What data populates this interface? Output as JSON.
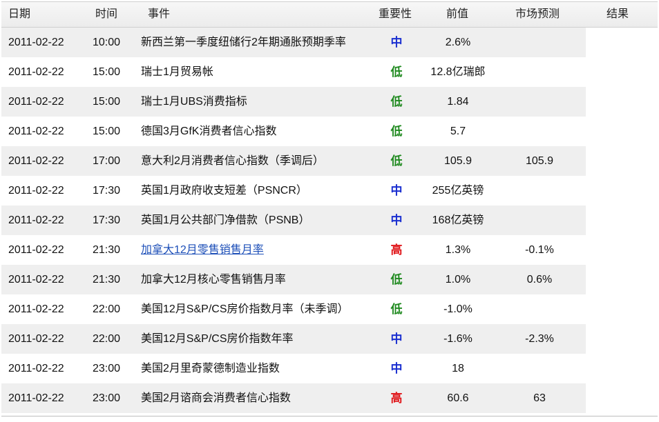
{
  "headers": {
    "date": "日期",
    "time": "时间",
    "event": "事件",
    "importance": "重要性",
    "previous": "前值",
    "forecast": "市场预测",
    "result": "结果"
  },
  "colors": {
    "importance_medium": "#1a2fd0",
    "importance_low": "#1f8a1f",
    "importance_high": "#e0161a",
    "link": "#1d4fb8"
  },
  "rows": [
    {
      "date": "2011-02-22",
      "time": "10:00",
      "event": "新西兰第一季度纽储行2年期通胀预期季率",
      "importance": "中",
      "previous": "2.6%",
      "forecast": "",
      "result": "",
      "link": false
    },
    {
      "date": "2011-02-22",
      "time": "15:00",
      "event": "瑞士1月贸易帐",
      "importance": "低",
      "previous": "12.8亿瑞郎",
      "forecast": "",
      "result": "",
      "link": false
    },
    {
      "date": "2011-02-22",
      "time": "15:00",
      "event": "瑞士1月UBS消费指标",
      "importance": "低",
      "previous": "1.84",
      "forecast": "",
      "result": "",
      "link": false
    },
    {
      "date": "2011-02-22",
      "time": "15:00",
      "event": "德国3月GfK消费者信心指数",
      "importance": "低",
      "previous": "5.7",
      "forecast": "",
      "result": "",
      "link": false
    },
    {
      "date": "2011-02-22",
      "time": "17:00",
      "event": "意大利2月消费者信心指数（季调后）",
      "importance": "低",
      "previous": "105.9",
      "forecast": "105.9",
      "result": "",
      "link": false
    },
    {
      "date": "2011-02-22",
      "time": "17:30",
      "event": "英国1月政府收支短差（PSNCR）",
      "importance": "中",
      "previous": "255亿英镑",
      "forecast": "",
      "result": "",
      "link": false
    },
    {
      "date": "2011-02-22",
      "time": "17:30",
      "event": "英国1月公共部门净借款（PSNB）",
      "importance": "中",
      "previous": "168亿英镑",
      "forecast": "",
      "result": "",
      "link": false
    },
    {
      "date": "2011-02-22",
      "time": "21:30",
      "event": "加拿大12月零售销售月率",
      "importance": "高",
      "previous": "1.3%",
      "forecast": "-0.1%",
      "result": "",
      "link": true
    },
    {
      "date": "2011-02-22",
      "time": "21:30",
      "event": "加拿大12月核心零售销售月率",
      "importance": "低",
      "previous": "1.0%",
      "forecast": "0.6%",
      "result": "",
      "link": false
    },
    {
      "date": "2011-02-22",
      "time": "22:00",
      "event": "美国12月S&P/CS房价指数月率（未季调）",
      "importance": "低",
      "previous": "-1.0%",
      "forecast": "",
      "result": "",
      "link": false
    },
    {
      "date": "2011-02-22",
      "time": "22:00",
      "event": "美国12月S&P/CS房价指数年率",
      "importance": "中",
      "previous": "-1.6%",
      "forecast": "-2.3%",
      "result": "",
      "link": false
    },
    {
      "date": "2011-02-22",
      "time": "23:00",
      "event": "美国2月里奇蒙德制造业指数",
      "importance": "中",
      "previous": "18",
      "forecast": "",
      "result": "",
      "link": false
    },
    {
      "date": "2011-02-22",
      "time": "23:00",
      "event": "美国2月谘商会消费者信心指数",
      "importance": "高",
      "previous": "60.6",
      "forecast": "63",
      "result": "",
      "link": false
    }
  ]
}
